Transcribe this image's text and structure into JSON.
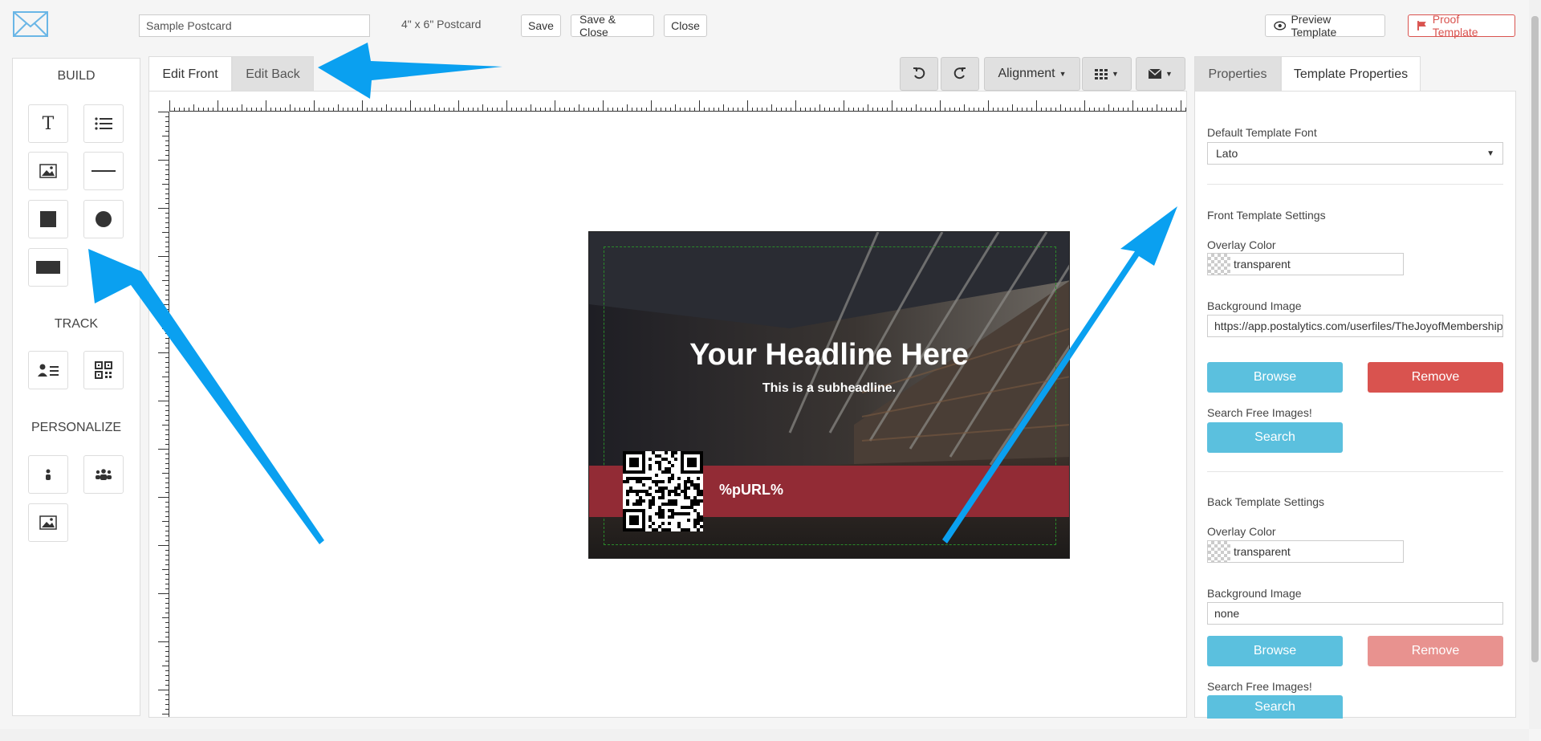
{
  "header": {
    "template_name": "Sample Postcard",
    "size_label": "4\" x 6\" Postcard",
    "save": "Save",
    "save_close": "Save & Close",
    "close": "Close",
    "preview": "Preview Template",
    "proof": "Proof Template"
  },
  "left_panel": {
    "build_title": "BUILD",
    "build_tools": [
      "text-tool-icon",
      "list-tool-icon",
      "image-tool-icon",
      "line-tool-icon",
      "square-tool-icon",
      "circle-tool-icon",
      "rectangle-tool-icon"
    ],
    "track_title": "TRACK",
    "track_tools": [
      "contact-card-icon",
      "qr-code-icon"
    ],
    "personalize_title": "PERSONALIZE",
    "personalize_tools": [
      "person-icon",
      "group-icon",
      "image-icon"
    ]
  },
  "editor_tabs": {
    "front": "Edit Front",
    "back": "Edit Back"
  },
  "toolbar": {
    "undo_icon": "undo-icon",
    "redo_icon": "redo-icon",
    "alignment": "Alignment",
    "grid_icon": "grid-icon",
    "envelope_icon": "envelope-icon"
  },
  "postcard": {
    "headline": "Your Headline Here",
    "subheadline": "This is a subheadline.",
    "purl": "%pURL%",
    "band_color": "#922b35"
  },
  "right_panel": {
    "tab_properties": "Properties",
    "tab_template_properties": "Template Properties",
    "default_font_label": "Default Template Font",
    "default_font_value": "Lato",
    "front_settings_title": "Front Template Settings",
    "front_overlay_label": "Overlay Color",
    "front_overlay_value": "transparent",
    "front_bg_label": "Background Image",
    "front_bg_value": "https://app.postalytics.com/userfiles/TheJoyofMembership",
    "browse": "Browse",
    "remove": "Remove",
    "search_free_label": "Search Free Images!",
    "search": "Search",
    "back_settings_title": "Back Template Settings",
    "back_overlay_label": "Overlay Color",
    "back_overlay_value": "transparent",
    "back_bg_label": "Background Image",
    "back_bg_value": "none"
  },
  "colors": {
    "info": "#5bc0de",
    "danger": "#d9534f",
    "arrow": "#0aa0f0"
  }
}
